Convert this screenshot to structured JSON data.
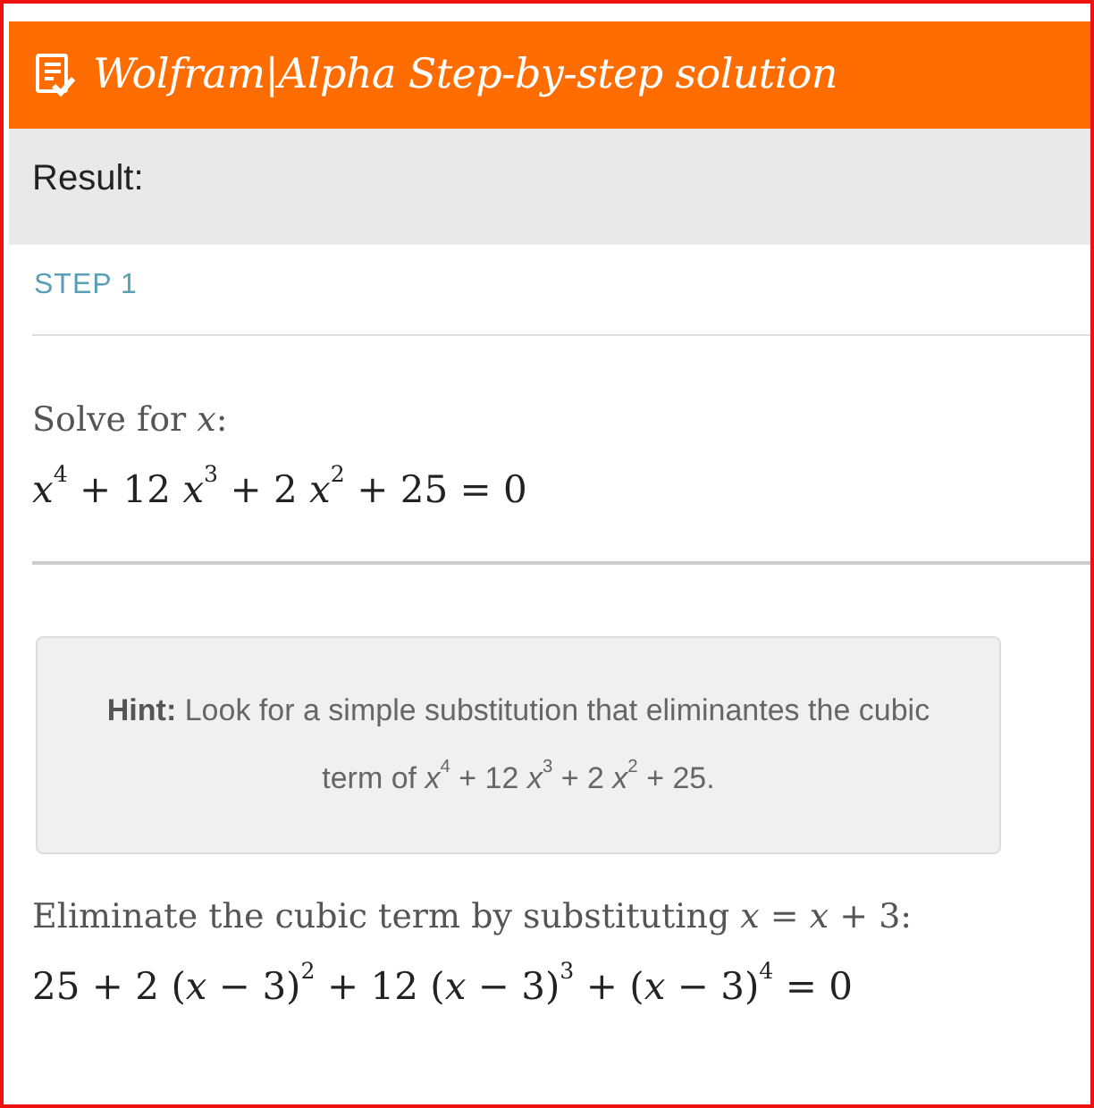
{
  "header": {
    "title": "Wolfram|Alpha Step-by-step solution"
  },
  "result_bar": {
    "label": "Result:"
  },
  "step": {
    "label": "STEP 1"
  },
  "blocks": [
    {
      "kind": "text",
      "text": "Solve for *x*:"
    },
    {
      "kind": "equation",
      "text": "*x*$^{4}$ + 12 *x*$^{3}$ + 2 *x*$^{2}$ + 25 = 0"
    },
    {
      "kind": "rule"
    },
    {
      "kind": "hint",
      "text": "**Hint:** Look for a simple substitution that eliminantes the cubic term of *x*$^{4}$ + 12 *x*$^{3}$ + 2 *x*$^{2}$ + 25."
    },
    {
      "kind": "text",
      "text": "Eliminate the cubic term by substituting *x* = *x* + 3:"
    },
    {
      "kind": "equation",
      "text": "25 + 2 (*x* − 3)$^{2}$ + 12 (*x* − 3)$^{3}$ + (*x* − 3)$^{4}$ = 0"
    }
  ]
}
